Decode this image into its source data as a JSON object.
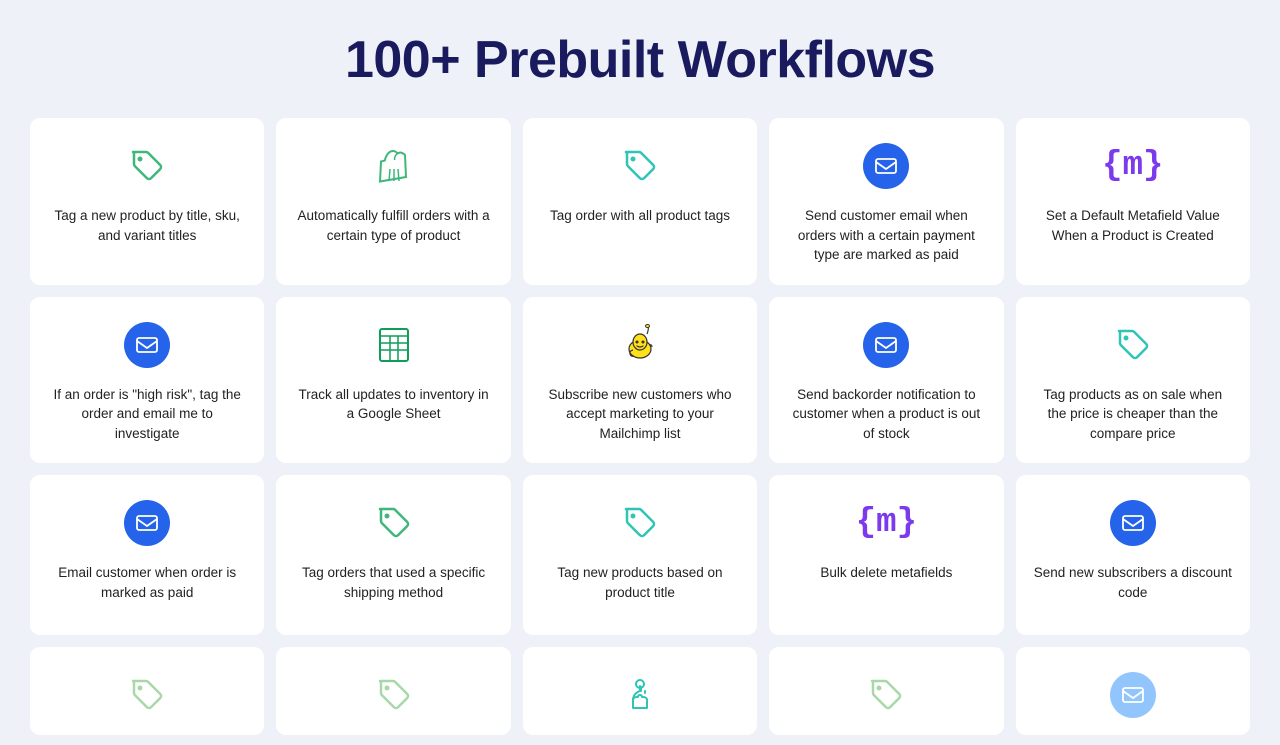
{
  "page": {
    "title": "100+ Prebuilt Workflows"
  },
  "cards": [
    {
      "id": "card-1",
      "icon_type": "tag",
      "icon_color": "#3db87a",
      "text": "Tag a new product by title, sku, and variant titles"
    },
    {
      "id": "card-2",
      "icon_type": "shopify",
      "icon_color": "#3db87a",
      "text": "Automatically fulfill orders with a certain type of product"
    },
    {
      "id": "card-3",
      "icon_type": "tag",
      "icon_color": "#2ec4b6",
      "text": "Tag order with all product tags"
    },
    {
      "id": "card-4",
      "icon_type": "email_circle",
      "icon_color": "#2563eb",
      "text": "Send customer email when orders with a certain payment type are marked as paid"
    },
    {
      "id": "card-5",
      "icon_type": "metafield",
      "icon_color": "#7c3aed",
      "text": "Set a Default Metafield Value When a Product is Created"
    },
    {
      "id": "card-6",
      "icon_type": "email_circle",
      "icon_color": "#2563eb",
      "text": "If an order is \"high risk\", tag the order and email me to investigate"
    },
    {
      "id": "card-7",
      "icon_type": "sheets",
      "icon_color": "#0f9d58",
      "text": "Track all updates to inventory in a Google Sheet"
    },
    {
      "id": "card-8",
      "icon_type": "mailchimp",
      "icon_color": "#ffe01b",
      "text": "Subscribe new customers who accept marketing to your Mailchimp list"
    },
    {
      "id": "card-9",
      "icon_type": "email_circle",
      "icon_color": "#2563eb",
      "text": "Send backorder notification to customer when a product is out of stock"
    },
    {
      "id": "card-10",
      "icon_type": "tag",
      "icon_color": "#2ec4b6",
      "text": "Tag products as on sale when the price is cheaper than the compare price"
    },
    {
      "id": "card-11",
      "icon_type": "email_circle",
      "icon_color": "#2563eb",
      "text": "Email customer when order is marked as paid"
    },
    {
      "id": "card-12",
      "icon_type": "tag",
      "icon_color": "#3db87a",
      "text": "Tag orders that used a specific shipping method"
    },
    {
      "id": "card-13",
      "icon_type": "tag",
      "icon_color": "#2ec4b6",
      "text": "Tag new products based on product title"
    },
    {
      "id": "card-14",
      "icon_type": "metafield",
      "icon_color": "#7c3aed",
      "text": "Bulk delete metafields"
    },
    {
      "id": "card-15",
      "icon_type": "email_circle",
      "icon_color": "#2563eb",
      "text": "Send new subscribers a discount code"
    },
    {
      "id": "card-16",
      "icon_type": "tag",
      "icon_color": "#a8d8a8",
      "text": "",
      "partial": true
    },
    {
      "id": "card-17",
      "icon_type": "tag",
      "icon_color": "#a8d8a8",
      "text": "",
      "partial": true
    },
    {
      "id": "card-18",
      "icon_type": "touch",
      "icon_color": "#2ec4b6",
      "text": "",
      "partial": true
    },
    {
      "id": "card-19",
      "icon_type": "tag",
      "icon_color": "#a8d8a8",
      "text": "",
      "partial": true
    },
    {
      "id": "card-20",
      "icon_type": "email_circle_light",
      "icon_color": "#93c5fd",
      "text": "",
      "partial": true
    }
  ]
}
